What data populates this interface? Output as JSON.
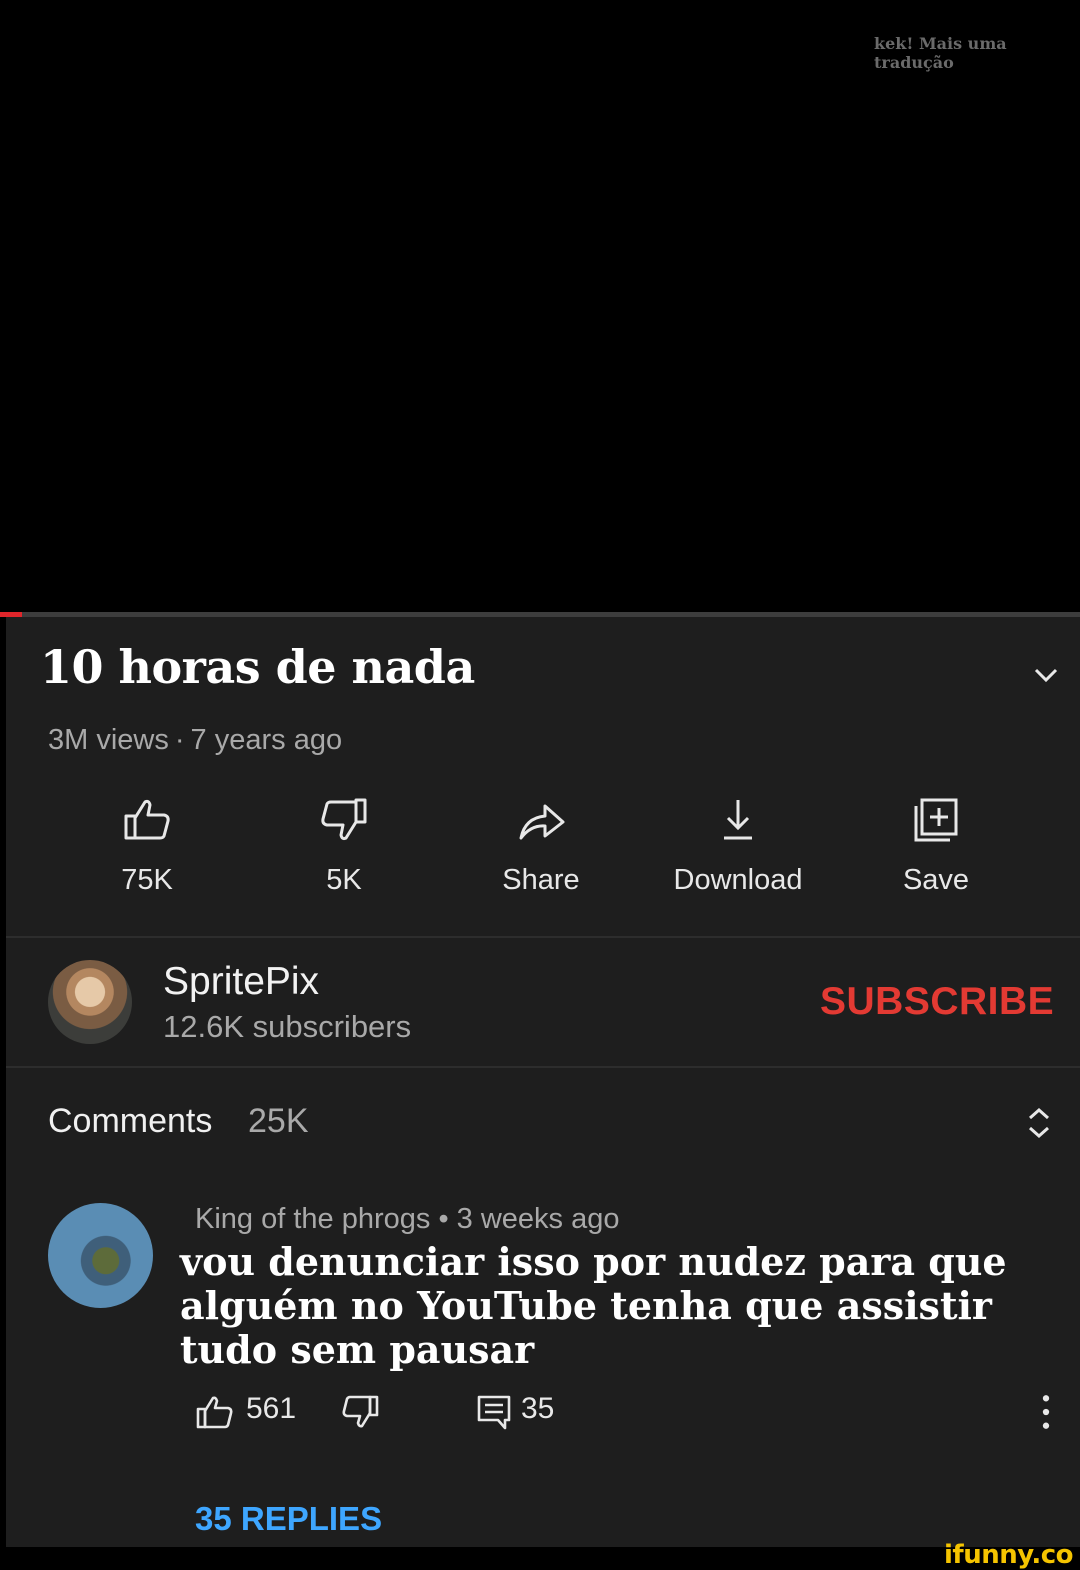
{
  "watermark_top": "kek! Mais uma tradução",
  "player": {
    "progress_percent": 2,
    "progress_color": "#e0262b"
  },
  "video": {
    "title": "10 horas de nada",
    "views": "3M views",
    "age": "7 years ago",
    "separator": "·"
  },
  "actions": [
    {
      "icon": "thumbs-up-icon",
      "label": "75K"
    },
    {
      "icon": "thumbs-down-icon",
      "label": "5K"
    },
    {
      "icon": "share-icon",
      "label": "Share"
    },
    {
      "icon": "download-icon",
      "label": "Download"
    },
    {
      "icon": "save-playlist-icon",
      "label": "Save"
    }
  ],
  "channel": {
    "name": "SpritePix",
    "subscribers": "12.6K subscribers",
    "subscribe_label": "SUBSCRIBE",
    "subscribe_color": "#e33a33"
  },
  "comments": {
    "heading": "Comments",
    "count": "25K",
    "top": {
      "author": "King of the phrogs",
      "separator": "•",
      "age": "3 weeks ago",
      "text": "vou denunciar isso por nudez para que alguém no YouTube tenha que assistir tudo sem pausar",
      "likes": "561",
      "reply_count": "35",
      "replies_link": "35 REPLIES",
      "replies_color": "#3ea6ff"
    }
  },
  "watermark_bottom": "ifunny.co"
}
